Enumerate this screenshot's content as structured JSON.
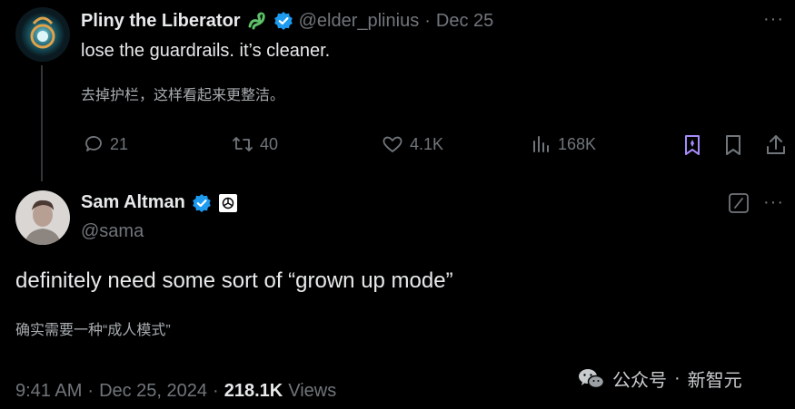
{
  "colors": {
    "background": "#000000",
    "text": "#e7e9ea",
    "muted": "#71767b",
    "verified": "#1d9bf0",
    "bookmark_accent": "#a78bfa"
  },
  "quoted": {
    "name": "Pliny the Liberator",
    "name_emoji": "dragon-emoji",
    "handle": "@elder_plinius",
    "separator": "·",
    "date": "Dec 25",
    "more": "···",
    "text": "lose the guardrails. it’s cleaner.",
    "translation": "去掉护栏，这样看起来更整洁。",
    "actions": {
      "replies": "21",
      "reposts": "40",
      "likes": "4.1K",
      "views": "168K"
    },
    "action_icons": [
      "reply-icon",
      "repost-icon",
      "like-icon",
      "views-icon",
      "grok-bookmark-icon",
      "bookmark-icon",
      "share-icon"
    ]
  },
  "main": {
    "name": "Sam Altman",
    "handle": "@sama",
    "more": "···",
    "text": "definitely need some sort of “grown up mode”",
    "translation": "确实需要一种“成人模式”",
    "time": "9:41 AM",
    "separator1": "·",
    "date": "Dec 25, 2024",
    "separator2": "·",
    "views_count": "218.1K",
    "views_label": "Views"
  },
  "watermark": {
    "brand": "公众号",
    "separator": "·",
    "name": "新智元"
  }
}
